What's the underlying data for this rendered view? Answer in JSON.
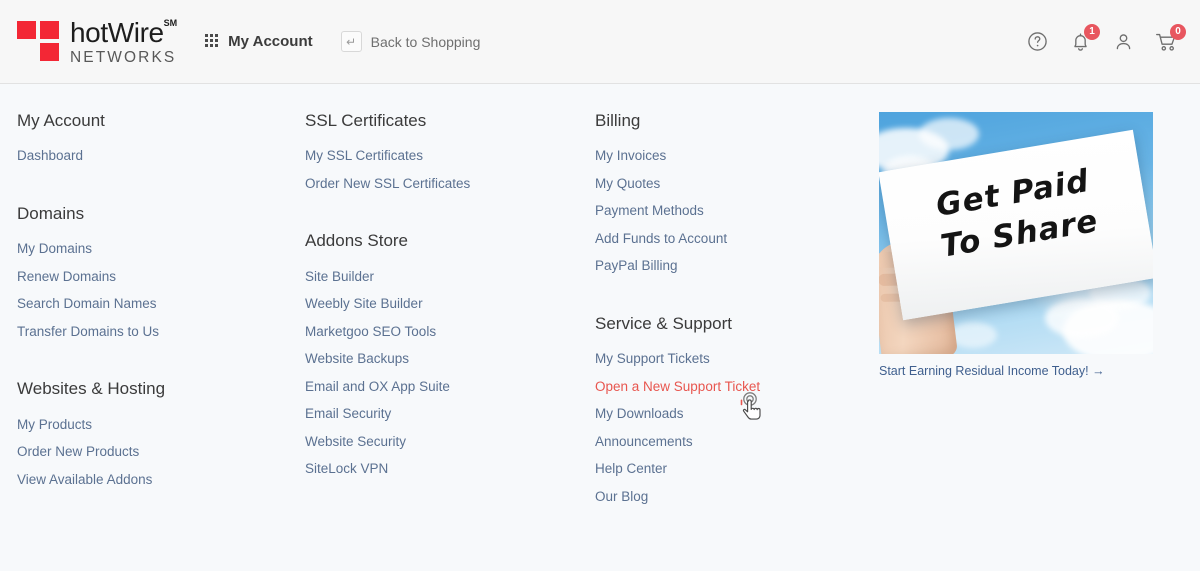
{
  "header": {
    "brand": {
      "name_top": "hotWire",
      "sm_mark": "SM",
      "name_bottom": "NETWORKS",
      "logo_color": "#f32735"
    },
    "account_button": {
      "label": "My Account",
      "icon": "grid-apps-icon"
    },
    "back_button": {
      "label": "Back to Shopping",
      "icon": "return-arrow-icon",
      "glyph": "↵"
    },
    "icons": [
      {
        "name": "help-icon",
        "badge": null
      },
      {
        "name": "notifications-bell-icon",
        "badge": "1"
      },
      {
        "name": "user-account-icon",
        "badge": null
      },
      {
        "name": "shopping-cart-icon",
        "badge": "0"
      }
    ],
    "badge_color": "#e8565f"
  },
  "columns": [
    {
      "groups": [
        {
          "title": "My Account",
          "links": [
            {
              "label": "Dashboard",
              "hovered": false
            }
          ]
        },
        {
          "title": "Domains",
          "links": [
            {
              "label": "My Domains",
              "hovered": false
            },
            {
              "label": "Renew Domains",
              "hovered": false
            },
            {
              "label": "Search Domain Names",
              "hovered": false
            },
            {
              "label": "Transfer Domains to Us",
              "hovered": false
            }
          ]
        },
        {
          "title": "Websites & Hosting",
          "links": [
            {
              "label": "My Products",
              "hovered": false
            },
            {
              "label": "Order New Products",
              "hovered": false
            },
            {
              "label": "View Available Addons",
              "hovered": false
            }
          ]
        }
      ]
    },
    {
      "groups": [
        {
          "title": "SSL Certificates",
          "links": [
            {
              "label": "My SSL Certificates",
              "hovered": false
            },
            {
              "label": "Order New SSL Certificates",
              "hovered": false
            }
          ]
        },
        {
          "title": "Addons Store",
          "links": [
            {
              "label": "Site Builder",
              "hovered": false
            },
            {
              "label": "Weebly Site Builder",
              "hovered": false
            },
            {
              "label": "Marketgoo SEO Tools",
              "hovered": false
            },
            {
              "label": "Website Backups",
              "hovered": false
            },
            {
              "label": "Email and OX App Suite",
              "hovered": false
            },
            {
              "label": "Email Security",
              "hovered": false
            },
            {
              "label": "Website Security",
              "hovered": false
            },
            {
              "label": "SiteLock VPN",
              "hovered": false
            }
          ]
        }
      ]
    },
    {
      "groups": [
        {
          "title": "Billing",
          "links": [
            {
              "label": "My Invoices",
              "hovered": false
            },
            {
              "label": "My Quotes",
              "hovered": false
            },
            {
              "label": "Payment Methods",
              "hovered": false
            },
            {
              "label": "Add Funds to Account",
              "hovered": false
            },
            {
              "label": "PayPal Billing",
              "hovered": false
            }
          ]
        },
        {
          "title": "Service & Support",
          "links": [
            {
              "label": "My Support Tickets",
              "hovered": false
            },
            {
              "label": "Open a New Support Ticket",
              "hovered": true
            },
            {
              "label": "My Downloads",
              "hovered": false
            },
            {
              "label": "Announcements",
              "hovered": false
            },
            {
              "label": "Help Center",
              "hovered": false
            },
            {
              "label": "Our Blog",
              "hovered": false
            }
          ]
        }
      ]
    }
  ],
  "promo": {
    "sign_line_1": "Get Paid",
    "sign_line_2": "To Share",
    "caption": "Start Earning Residual Income Today! →"
  },
  "colors": {
    "page_background": "#f7f9fb",
    "header_background": "#f7f7f7",
    "link": "#5b7191",
    "link_hover": "#e8564f",
    "heading": "#3b3b3b"
  },
  "cursor": {
    "type": "pointing-hand-tap"
  }
}
